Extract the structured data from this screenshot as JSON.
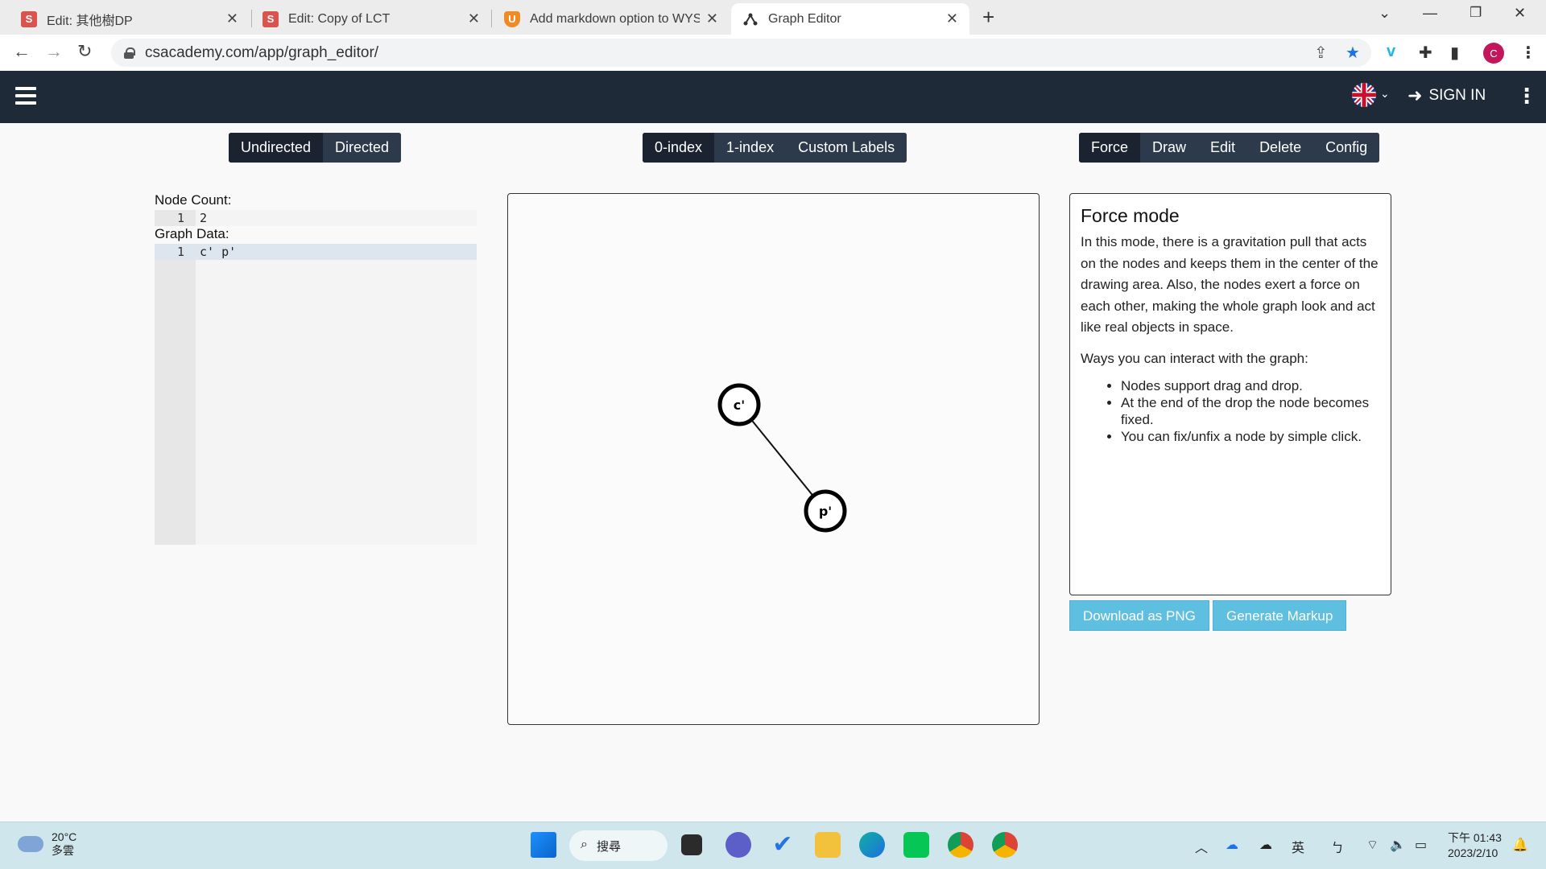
{
  "browser": {
    "tabs": [
      {
        "title": "Edit: 其他樹DP",
        "favicon": "S"
      },
      {
        "title": "Edit: Copy of LCT",
        "favicon": "S"
      },
      {
        "title": "Add markdown option to WYSI",
        "favicon": "U"
      },
      {
        "title": "Graph Editor",
        "favicon": "graph-icon"
      }
    ],
    "url": "csacademy.com/app/graph_editor/",
    "profile_initial": "C"
  },
  "header": {
    "signin_label": "SIGN IN"
  },
  "toolbar": {
    "direction": [
      "Undirected",
      "Directed"
    ],
    "indexing": [
      "0-index",
      "1-index",
      "Custom Labels"
    ],
    "modes": [
      "Force",
      "Draw",
      "Edit",
      "Delete",
      "Config"
    ]
  },
  "editor": {
    "node_count_label": "Node Count:",
    "node_count_lines": [
      {
        "n": "1",
        "text": "2"
      }
    ],
    "graph_data_label": "Graph Data:",
    "graph_data_lines": [
      {
        "n": "1",
        "text": "c' p'"
      }
    ]
  },
  "graph": {
    "nodes": [
      {
        "label": "c'"
      },
      {
        "label": "p'"
      }
    ],
    "edges": [
      [
        "c'",
        "p'"
      ]
    ]
  },
  "info": {
    "title": "Force mode",
    "description": "In this mode, there is a gravitation pull that acts on the nodes and keeps them in the center of the drawing area. Also, the nodes exert a force on each other, making the whole graph look and act like real objects in space.",
    "ways_title": "Ways you can interact with the graph:",
    "bullets": [
      "Nodes support drag and drop.",
      "At the end of the drop the node becomes fixed.",
      "You can fix/unfix a node by simple click."
    ]
  },
  "actions": {
    "download_label": "Download as PNG",
    "markup_label": "Generate Markup"
  },
  "taskbar": {
    "weather_temp": "20°C",
    "weather_desc": "多雲",
    "search_label": "搜尋",
    "ime_label": "英",
    "ime_mode": "ㄅ",
    "time": "下午 01:43",
    "date": "2023/2/10"
  },
  "colors": {
    "app_header": "#1f2a38",
    "button": "#2c3a4b",
    "button_active": "#1a232f",
    "action_button": "#5fbfe0"
  }
}
